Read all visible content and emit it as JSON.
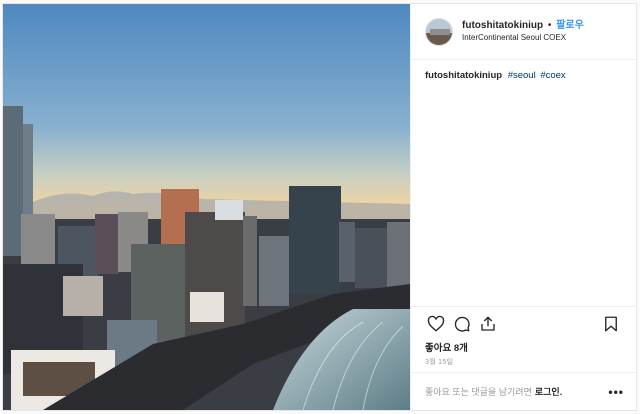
{
  "post": {
    "username": "futoshitatokiniup",
    "separator": "•",
    "follow_label": "팔로우",
    "location": "InterContinental Seoul COEX",
    "caption": {
      "username": "futoshitatokiniup",
      "tags": [
        "#seoul",
        "#coex"
      ]
    },
    "likes_text": "좋아요 8개",
    "date_text": "3월 15일",
    "login_prompt_text": "좋아요 또는 댓글을 남기려면",
    "login_link_label": "로그인.",
    "login_prompt_suffix": "",
    "more_label": "•••"
  },
  "icons": {
    "like": "heart-icon",
    "comment": "comment-icon",
    "share": "share-icon",
    "save": "bookmark-icon"
  },
  "colors": {
    "link_blue": "#3897f0",
    "hashtag": "#003569",
    "muted": "#999999"
  }
}
